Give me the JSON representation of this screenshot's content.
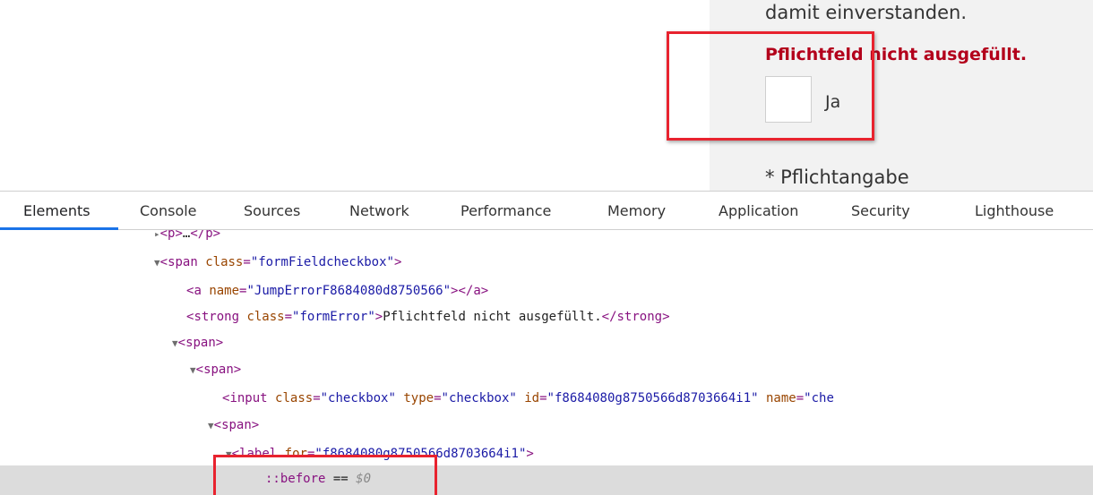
{
  "preview": {
    "consent_text": "damit einverstanden.",
    "form_error": "Pflichtfeld nicht ausgefüllt.",
    "checkbox_label": "Ja",
    "required_note": "* Pflichtangabe"
  },
  "devtools": {
    "tabs": [
      {
        "label": "Elements",
        "active": true
      },
      {
        "label": "Console"
      },
      {
        "label": "Sources"
      },
      {
        "label": "Network"
      },
      {
        "label": "Performance"
      },
      {
        "label": "Memory"
      },
      {
        "label": "Application"
      },
      {
        "label": "Security"
      },
      {
        "label": "Lighthouse"
      }
    ]
  },
  "tree": {
    "line0": {
      "open": "<p>",
      "ellipsis": "…",
      "close": "</p>"
    },
    "line1": {
      "tag": "span",
      "attr": "class",
      "value": "\"formFieldcheckbox\""
    },
    "line2": {
      "tag": "a",
      "attr": "name",
      "value": "\"JumpErrorF8684080d8750566\"",
      "close": "></a>"
    },
    "line3": {
      "tag": "strong",
      "attr": "class",
      "value": "\"formError\"",
      "text": "Pflichtfeld nicht ausgefüllt.",
      "close": "</strong>"
    },
    "line4": {
      "tag": "span"
    },
    "line5": {
      "tag": "span"
    },
    "line6": {
      "tag": "input",
      "attr1": "class",
      "val1": "\"checkbox\"",
      "attr2": "type",
      "val2": "\"checkbox\"",
      "attr3": "id",
      "val3": "\"f8684080g8750566d8703664i1\"",
      "attr4": "name",
      "val4": "\"che"
    },
    "line7": {
      "tag": "span"
    },
    "line8": {
      "tag": "label",
      "attr": "for",
      "value": "\"f8684080g8750566d8703664i1\""
    },
    "line9": {
      "pseudo": "::before",
      "eq": "==",
      "ref": "$0"
    }
  }
}
